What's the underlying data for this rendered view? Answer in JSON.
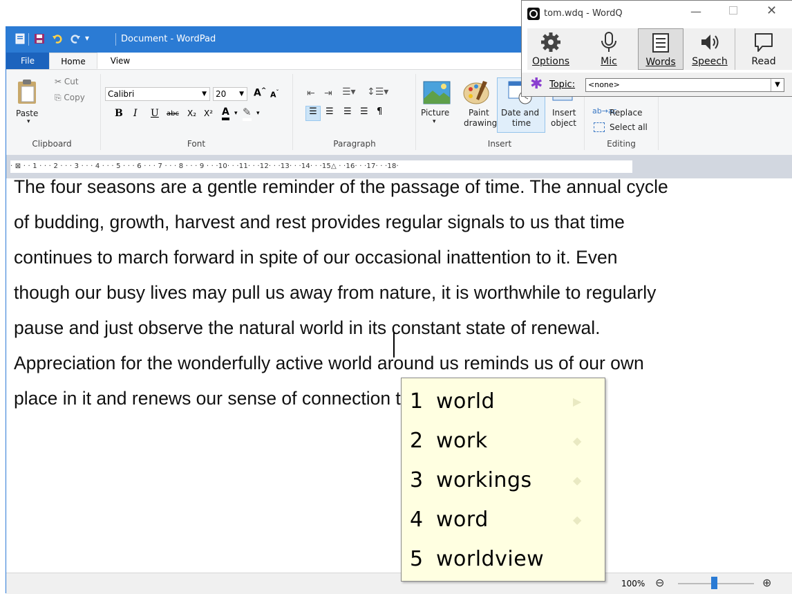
{
  "wordpad": {
    "title": "Document - WordPad",
    "tabs": {
      "file": "File",
      "home": "Home",
      "view": "View"
    },
    "clipboard": {
      "paste": "Paste",
      "cut": "Cut",
      "copy": "Copy",
      "label": "Clipboard"
    },
    "font": {
      "name": "Calibri",
      "size": "20",
      "label": "Font",
      "bold": "B",
      "italic": "I",
      "underline": "U",
      "strike": "abc",
      "subscript": "X₂",
      "superscript": "X²",
      "grow": "A",
      "shrink": "A",
      "color": "A"
    },
    "paragraph": {
      "label": "Paragraph"
    },
    "insert": {
      "picture": "Picture",
      "paint_line1": "Paint",
      "paint_line2": "drawing",
      "datetime_line1": "Date and",
      "datetime_line2": "time",
      "object_line1": "Insert",
      "object_line2": "object",
      "label": "Insert"
    },
    "editing": {
      "replace": "Replace",
      "select_all": "Select all",
      "label": "Editing"
    },
    "ruler": "· ⊠ · · 1 · · · 2 · · · 3 · · · 4 · · · 5 · · · 6 · · · 7 · · · 8 · · · 9 · · ·10· · ·11· · ·12· · ·13· · ·14· · ·15△ · ·16· · ·17· · ·18·",
    "document_lines": [
      "The four seasons are a gentle reminder of the passage of time. The annual cycle",
      "of budding, growth, harvest and rest provides regular signals to us that time",
      "continues to march forward in spite of our occasional inattention to it. Even",
      "though our busy lives may pull us away from nature, it is worthwhile to regularly",
      "pause and just observe the natural world in its constant state of renewal.",
      "Appreciation for the wonderfully active world around us reminds us of our own",
      "place in it and renews our sense of connection to it and to each other."
    ],
    "zoom": "100%",
    "zoom_level_percent": 100
  },
  "wordq": {
    "title": "tom.wdq - WordQ",
    "buttons": {
      "options": "Options",
      "mic": "Mic",
      "words": "Words",
      "speech": "Speech",
      "read": "Read"
    },
    "topic_label": "Topic:",
    "topic_value": "<none>"
  },
  "prediction": {
    "items": [
      {
        "n": "1",
        "word": "world"
      },
      {
        "n": "2",
        "word": "work"
      },
      {
        "n": "3",
        "word": "workings"
      },
      {
        "n": "4",
        "word": "word"
      },
      {
        "n": "5",
        "word": "worldview"
      }
    ]
  },
  "colors": {
    "title_bar": "#2b7bd4",
    "file_tab": "#1c63bd",
    "popup_bg": "#ffffe1"
  }
}
